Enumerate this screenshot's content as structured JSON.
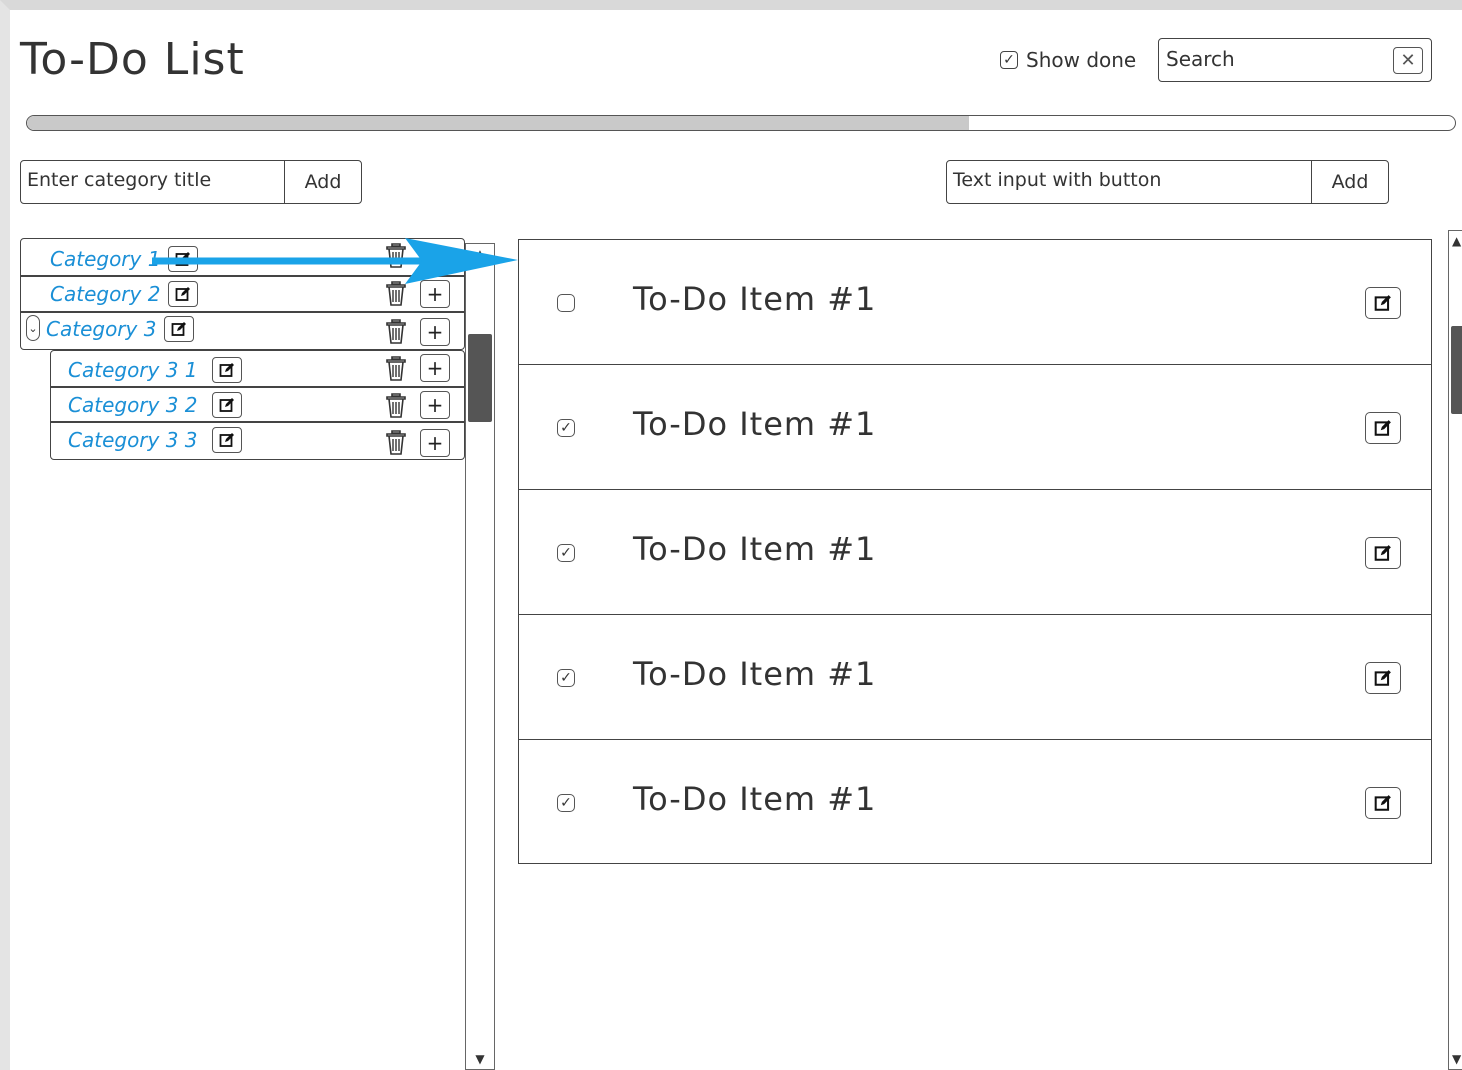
{
  "app": {
    "title": "To-Do List"
  },
  "header": {
    "show_done_label": "Show done",
    "show_done_checked": true,
    "search_value": "Search",
    "search_clear_icon": "close-icon"
  },
  "progress": {
    "value_percent": 66
  },
  "category_input": {
    "placeholder": "Enter category title",
    "button": "Add"
  },
  "todo_input": {
    "placeholder": "Text input with button",
    "button": "Add"
  },
  "categories": [
    {
      "label": "Category 1",
      "selected": true
    },
    {
      "label": "Category 2"
    },
    {
      "label": "Category 3",
      "expanded": true
    },
    {
      "label": "Category 3  1"
    },
    {
      "label": "Category 3  2"
    },
    {
      "label": "Category 3  3"
    }
  ],
  "todos": [
    {
      "text": "To-Do Item #1",
      "done": false
    },
    {
      "text": "To-Do Item #1",
      "done": true
    },
    {
      "text": "To-Do Item #1",
      "done": true
    },
    {
      "text": "To-Do Item #1",
      "done": true
    },
    {
      "text": "To-Do Item #1",
      "done": true
    }
  ],
  "colors": {
    "category_link": "#1a8fd6",
    "arrow": "#1aa3e8"
  }
}
